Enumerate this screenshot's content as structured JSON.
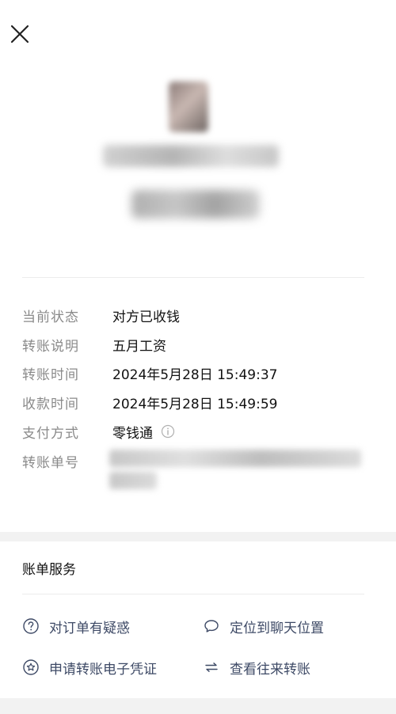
{
  "header": {
    "close_icon": "close-icon"
  },
  "details": [
    {
      "label": "当前状态",
      "value": "对方已收钱"
    },
    {
      "label": "转账说明",
      "value": "五月工资"
    },
    {
      "label": "转账时间",
      "value": "2024年5月28日 15:49:37"
    },
    {
      "label": "收款时间",
      "value": "2024年5月28日 15:49:59"
    },
    {
      "label": "支付方式",
      "value": "零钱通",
      "icon": "info-icon"
    },
    {
      "label": "转账单号"
    }
  ],
  "services": {
    "title": "账单服务",
    "items": [
      {
        "label": "对订单有疑惑",
        "icon": "question-circle-icon"
      },
      {
        "label": "定位到聊天位置",
        "icon": "chat-bubble-icon"
      },
      {
        "label": "申请转账电子凭证",
        "icon": "star-badge-icon"
      },
      {
        "label": "查看往来转账",
        "icon": "swap-arrows-icon"
      }
    ]
  },
  "colors": {
    "label_gray": "#8a8a8a",
    "link_blue": "#3e4a66",
    "divider": "#ececec",
    "section_bg": "#f2f2f2"
  }
}
